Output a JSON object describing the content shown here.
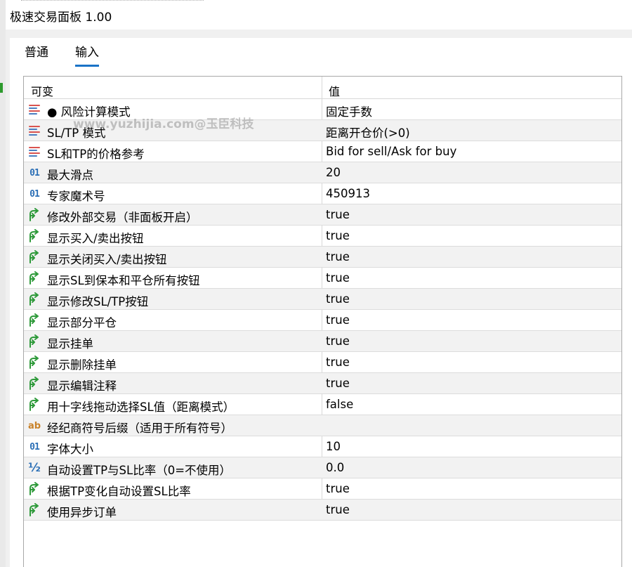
{
  "window": {
    "title": "极速交易面板 1.00"
  },
  "tabs": [
    {
      "label": "普通",
      "active": false
    },
    {
      "label": "输入",
      "active": true
    }
  ],
  "table": {
    "headers": {
      "variable": "可变",
      "value": "值"
    },
    "rows": [
      {
        "icon": "enum-icon",
        "name": "● 风险计算模式",
        "value": "固定手数"
      },
      {
        "icon": "enum-icon",
        "name": "SL/TP 模式",
        "value": "距离开仓价(>0)"
      },
      {
        "icon": "enum-icon",
        "name": "SL和TP的价格参考",
        "value": "Bid for sell/Ask for buy"
      },
      {
        "icon": "integer-icon",
        "name": "最大滑点",
        "value": "20"
      },
      {
        "icon": "integer-icon",
        "name": "专家魔术号",
        "value": "450913"
      },
      {
        "icon": "bool-icon",
        "name": "修改外部交易（非面板开启）",
        "value": "true"
      },
      {
        "icon": "bool-icon",
        "name": "显示买入/卖出按钮",
        "value": "true"
      },
      {
        "icon": "bool-icon",
        "name": "显示关闭买入/卖出按钮",
        "value": "true"
      },
      {
        "icon": "bool-icon",
        "name": "显示SL到保本和平仓所有按钮",
        "value": "true"
      },
      {
        "icon": "bool-icon",
        "name": "显示修改SL/TP按钮",
        "value": "true"
      },
      {
        "icon": "bool-icon",
        "name": "显示部分平仓",
        "value": "true"
      },
      {
        "icon": "bool-icon",
        "name": "显示挂单",
        "value": "true"
      },
      {
        "icon": "bool-icon",
        "name": "显示删除挂单",
        "value": "true"
      },
      {
        "icon": "bool-icon",
        "name": "显示编辑注释",
        "value": "true"
      },
      {
        "icon": "bool-icon",
        "name": "用十字线拖动选择SL值（距离模式）",
        "value": "false"
      },
      {
        "icon": "string-icon",
        "name": "经纪商符号后缀（适用于所有符号）",
        "value": ""
      },
      {
        "icon": "integer-icon",
        "name": "字体大小",
        "value": "10"
      },
      {
        "icon": "double-icon",
        "name": "自动设置TP与SL比率（0=不使用）",
        "value": "0.0"
      },
      {
        "icon": "bool-icon",
        "name": "根据TP变化自动设置SL比率",
        "value": "true"
      },
      {
        "icon": "bool-icon",
        "name": "使用异步订单",
        "value": "true"
      }
    ]
  },
  "icons": {
    "integer-icon": "01",
    "string-icon": "ab",
    "double-icon": "½"
  },
  "watermark": "www.yuzhijia.com@玉臣科技",
  "colors": {
    "tab_underline": "#1a73c7",
    "bool_icon": "#2e9a3a",
    "int_icon": "#2b6fb6",
    "string_icon": "#c9822a",
    "enum_stripe_red": "#d9534f",
    "enum_stripe_blue": "#4a7fc1"
  }
}
